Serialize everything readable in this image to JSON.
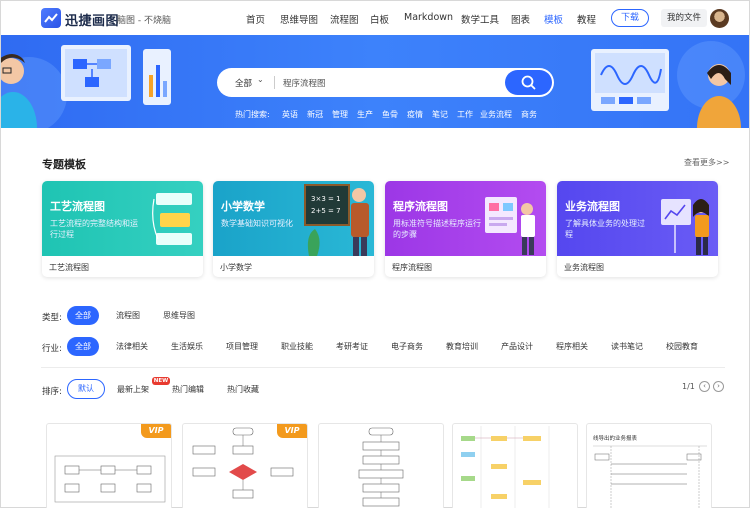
{
  "header": {
    "brand": "迅捷画图",
    "brand_sub": "脑图 - 不烧脑",
    "nav": [
      "首页",
      "思维导图",
      "流程图",
      "白板",
      "Markdown",
      "数学工具",
      "图表",
      "模板",
      "教程"
    ],
    "active_nav": "模板",
    "download_label": "下载",
    "my_files_label": "我的文件"
  },
  "banner": {
    "search_category": "全部",
    "search_value": "程序流程图",
    "hot_label": "热门搜索:",
    "hot_tags": [
      "英语",
      "新冠",
      "管理",
      "生产",
      "鱼骨",
      "疫情",
      "笔记",
      "工作",
      "业务流程",
      "商务"
    ],
    "board_text": "3×3 = 1",
    "board_text2": "2+5 = 7"
  },
  "topics": {
    "title": "专题模板",
    "see_more": "查看更多>>",
    "cards": [
      {
        "title": "工艺流程图",
        "desc": "工艺流程的完整结构和运行过程",
        "name": "工艺流程图"
      },
      {
        "title": "小学数学",
        "desc": "数学基础知识可视化",
        "name": "小学数学"
      },
      {
        "title": "程序流程图",
        "desc": "用标准符号描述程序运行的步骤",
        "name": "程序流程图"
      },
      {
        "title": "业务流程图",
        "desc": "了解具体业务的处理过程",
        "name": "业务流程图"
      }
    ]
  },
  "filters": {
    "type_label": "类型:",
    "types": [
      "全部",
      "流程图",
      "思维导图"
    ],
    "industry_label": "行业:",
    "industries": [
      "全部",
      "法律相关",
      "生活娱乐",
      "项目管理",
      "职业技能",
      "考研考证",
      "电子商务",
      "教育培训",
      "产品设计",
      "程序相关",
      "读书笔记",
      "校园教育"
    ],
    "sort_label": "排序:",
    "sorts": [
      "默认",
      "最新上架",
      "热门编辑",
      "热门收藏"
    ],
    "new_badge": "NEW",
    "pager": "1/1"
  },
  "templates": {
    "vip_label": "VIP",
    "thumb5_title": "线导出的业务报表"
  },
  "colors": {
    "accent": "#2c66ff",
    "banner": "#3479f8",
    "vip": "#f39a1d",
    "card1": "#1fc4b3",
    "card2": "#1aa3c9",
    "card3": "#a23be8",
    "card4": "#5a4bf0"
  }
}
